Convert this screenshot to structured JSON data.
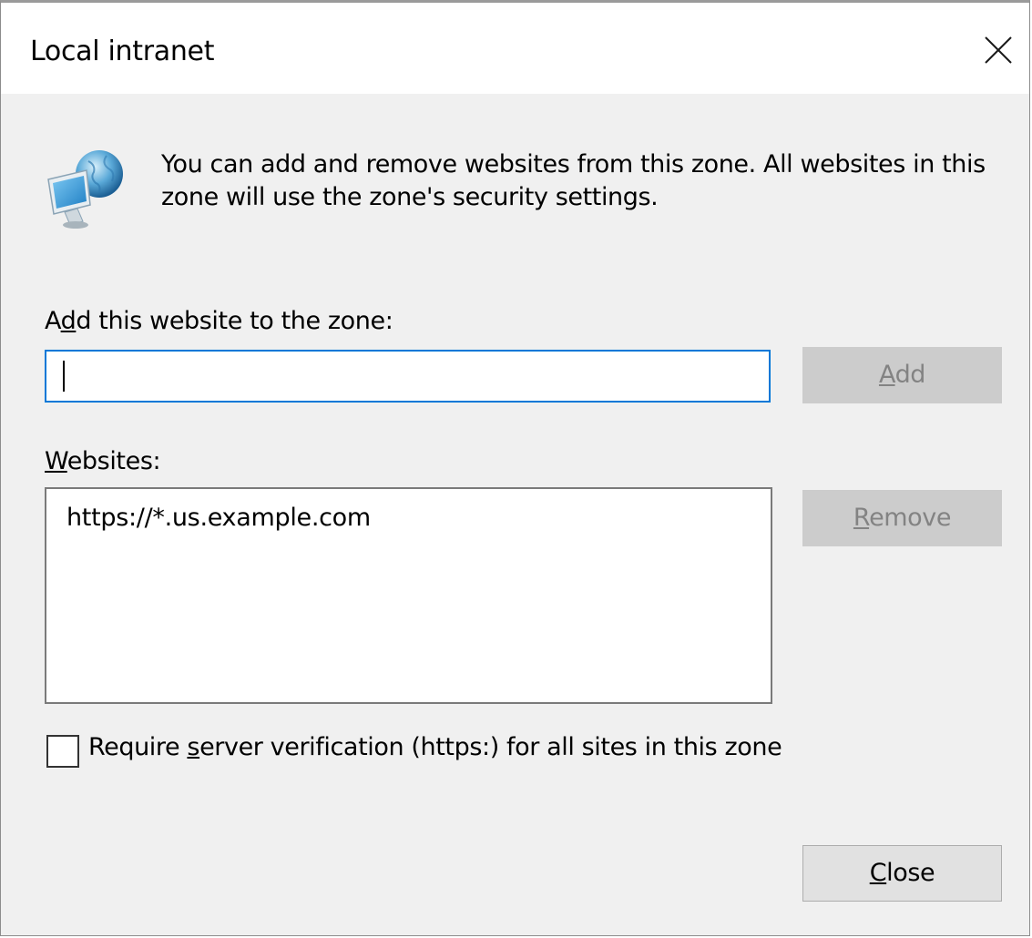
{
  "window": {
    "title": "Local intranet",
    "close_icon": "close-icon"
  },
  "info": {
    "icon": "globe-computer-icon",
    "description": "You can add and remove websites from this zone. All websites in this zone will use the zone's security settings."
  },
  "add_section": {
    "label_pre": "A",
    "label_accel": "d",
    "label_post": "d this website to the zone:",
    "input_value": "",
    "add_button": {
      "accel": "A",
      "rest": "dd",
      "enabled": false
    }
  },
  "websites_section": {
    "label_accel": "W",
    "label_rest": "ebsites:",
    "items": [
      "https://*.us.example.com"
    ],
    "remove_button": {
      "accel": "R",
      "rest": "emove",
      "enabled": false
    }
  },
  "verification": {
    "checked": false,
    "label_pre": "Require ",
    "label_accel": "s",
    "label_post": "erver verification (https:) for all sites in this zone"
  },
  "footer": {
    "close_button": {
      "accel": "C",
      "rest": "lose",
      "enabled": true
    }
  },
  "colors": {
    "focus_border": "#0078d7",
    "dialog_bg": "#f0f0f0",
    "disabled_button_bg": "#cccccc",
    "disabled_text": "#838383"
  }
}
